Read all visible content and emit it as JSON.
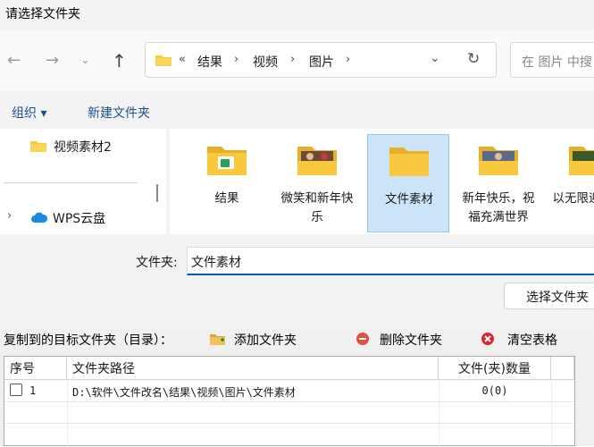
{
  "dialog": {
    "title": "请选择文件夹",
    "address": {
      "chevrons": "«",
      "crumbs": [
        "结果",
        "视频",
        "图片"
      ],
      "separator": "›"
    },
    "search_placeholder": "在 图片 中搜",
    "commands": {
      "organize": "组织 ▾",
      "new_folder": "新建文件夹"
    },
    "nav_items": [
      {
        "label": "视频素材2"
      },
      {
        "label": "WPS云盘"
      }
    ],
    "files": [
      {
        "label": "结果"
      },
      {
        "label": "微笑和新年快乐"
      },
      {
        "label": "文件素材"
      },
      {
        "label": "新年快乐，祝福充满世界"
      },
      {
        "label": "以无限迎接新"
      }
    ],
    "folder_label": "文件夹:",
    "folder_value": "文件素材",
    "select_button": "选择文件夹"
  },
  "panel": {
    "title": "复制到的目标文件夹（目录）：",
    "add_folder": "添加文件夹",
    "delete_folder": "删除文件夹",
    "clear_table": "清空表格",
    "columns": [
      "序号",
      "文件夹路径",
      "文件(夹)数量"
    ],
    "rows": [
      {
        "index": "1",
        "path": "D:\\软件\\文件改名\\结果\\视频\\图片\\文件素材",
        "count": "0(0)"
      }
    ]
  },
  "colors": {
    "accent": "#005fb8",
    "folder": "#f8c93e",
    "selection": "#cce4f7"
  }
}
